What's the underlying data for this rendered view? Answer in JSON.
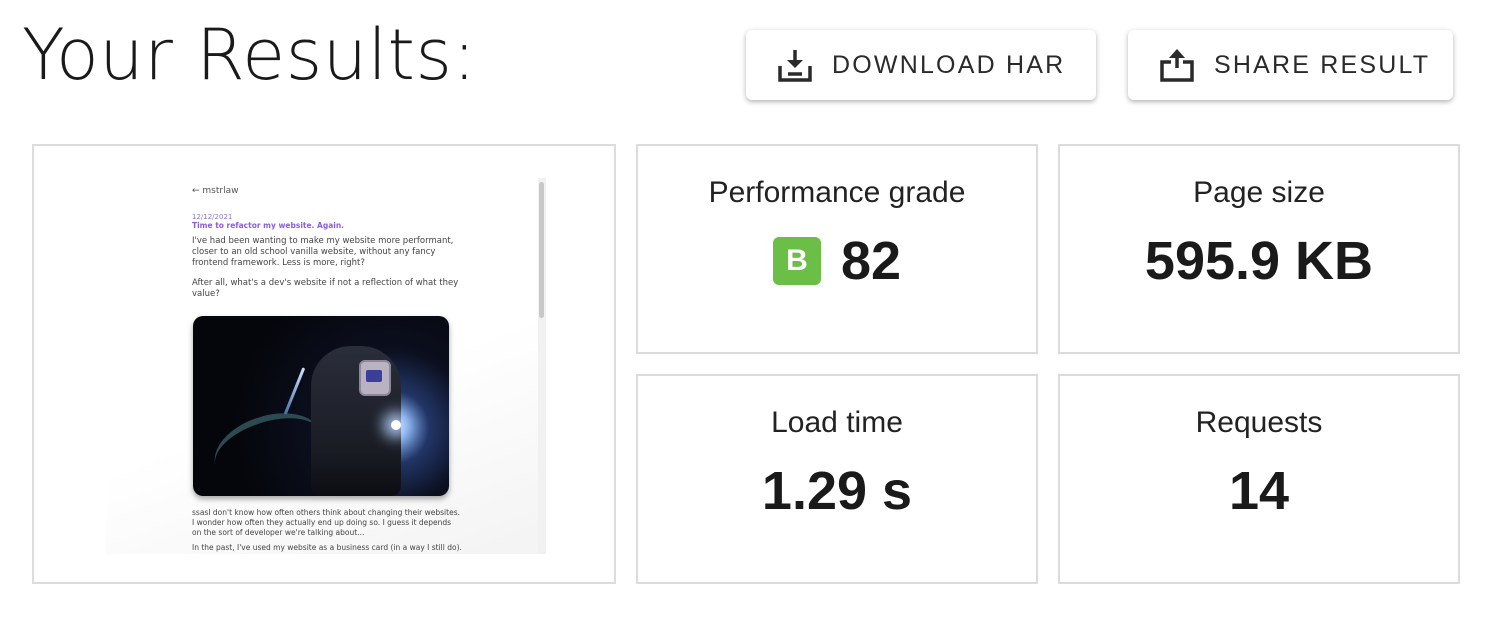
{
  "header": {
    "title": "Your Results:",
    "download_label": "DOWNLOAD HAR",
    "share_label": "SHARE RESULT"
  },
  "preview": {
    "back_link": "← mstrlaw",
    "date": "12/12/2021",
    "heading": "Time to refactor my website. Again.",
    "paragraph1": "I've had been wanting to make my website more performant, closer to an old school vanilla website, without any fancy frontend framework. Less is more, right?",
    "paragraph2": "After all, what's a dev's website if not a reflection of what they value?",
    "paragraph3": "ssasI don't know how often others think about changing their websites. I wonder how often they actually end up doing so. I guess it depends on the sort of developer we're talking about...",
    "paragraph4": "In the past, I've used my website as a business card (in a way I still do). But"
  },
  "metrics": {
    "grade_label": "Performance grade",
    "grade_letter": "B",
    "grade_score": "82",
    "size_label": "Page size",
    "size_value": "595.9 KB",
    "load_label": "Load time",
    "load_value": "1.29 s",
    "requests_label": "Requests",
    "requests_value": "14"
  },
  "colors": {
    "grade_badge": "#6bbf47",
    "card_border": "#dcdcdc"
  },
  "icons": {
    "download": "download-icon",
    "share": "share-icon"
  }
}
